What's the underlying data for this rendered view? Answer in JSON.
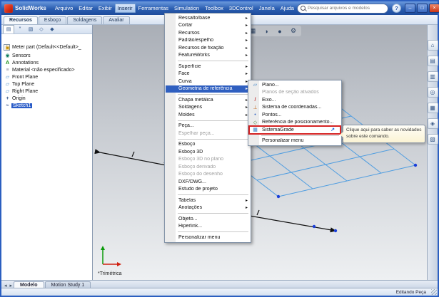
{
  "titlebar": {
    "app_name": "SolidWorks",
    "menus": [
      {
        "label": "Arquivo"
      },
      {
        "label": "Editar"
      },
      {
        "label": "Exibir"
      },
      {
        "label": "Inserir",
        "active": true
      },
      {
        "label": "Ferramentas"
      },
      {
        "label": "Simulation"
      },
      {
        "label": "Toolbox"
      },
      {
        "label": "3DControl"
      },
      {
        "label": "Janela"
      },
      {
        "label": "Ajuda"
      }
    ],
    "search_placeholder": "Pesquisar arquivos e modelos",
    "help_label": "?",
    "window_buttons": [
      {
        "name": "minimize-button",
        "glyph": "–"
      },
      {
        "name": "restore-button",
        "glyph": "□"
      },
      {
        "name": "close-button",
        "glyph": "×",
        "close": true
      }
    ]
  },
  "command_tabs": {
    "items": [
      {
        "label": "Recursos",
        "active": true
      },
      {
        "label": "Esboço"
      },
      {
        "label": "Soldagens"
      },
      {
        "label": "Avaliar"
      }
    ]
  },
  "feature_tree": {
    "root_label": "Meter part (Default<<Default>_",
    "items": [
      {
        "label": "Sensors",
        "icon": "sensors-icon"
      },
      {
        "label": "Annotations",
        "icon": "annotations-icon"
      },
      {
        "label": "Material <não especificado>",
        "icon": "material-icon"
      },
      {
        "label": "Front Plane",
        "icon": "plane-icon"
      },
      {
        "label": "Top Plane",
        "icon": "plane-icon"
      },
      {
        "label": "Right Plane",
        "icon": "plane-icon"
      },
      {
        "label": "Origin",
        "icon": "origin-icon"
      },
      {
        "label": "Sketch1",
        "icon": "sketch-icon",
        "selected": true
      }
    ]
  },
  "panel_tabs": {
    "items": [
      {
        "name": "featuremanager-tab-icon",
        "glyph": "▤",
        "active": true
      },
      {
        "name": "propertymanager-tab-icon",
        "glyph": "*"
      },
      {
        "name": "configurationmanager-tab-icon",
        "glyph": "▧"
      },
      {
        "name": "dimxpert-tab-icon",
        "glyph": "◇"
      },
      {
        "name": "displaymanager-tab-icon",
        "glyph": "◆"
      }
    ]
  },
  "insert_menu": {
    "items": [
      {
        "label": "Ressalto/base",
        "arrow": true
      },
      {
        "label": "Cortar",
        "arrow": true
      },
      {
        "label": "Recursos",
        "arrow": true
      },
      {
        "label": "Padrão/espelho",
        "arrow": true
      },
      {
        "label": "Recursos de fixação",
        "arrow": true
      },
      {
        "label": "FeatureWorks",
        "arrow": true
      },
      {
        "sep": true
      },
      {
        "label": "Superfície",
        "arrow": true
      },
      {
        "label": "Face",
        "arrow": true
      },
      {
        "label": "Curva",
        "arrow": true
      },
      {
        "label": "Geometria de referência",
        "arrow": true,
        "highlight": true
      },
      {
        "sep": true
      },
      {
        "label": "Chapa metálica",
        "arrow": true
      },
      {
        "label": "Soldagens",
        "arrow": true
      },
      {
        "label": "Moldes",
        "arrow": true
      },
      {
        "sep": true
      },
      {
        "label": "Peça..."
      },
      {
        "label": "Espelhar peça...",
        "disabled": true
      },
      {
        "sep": true
      },
      {
        "label": "Esboço"
      },
      {
        "label": "Esboço 3D"
      },
      {
        "label": "Esboço 3D no plano",
        "disabled": true
      },
      {
        "label": "Esboço derivado",
        "disabled": true
      },
      {
        "label": "Esboço do desenho",
        "disabled": true
      },
      {
        "label": "DXF/DWG..."
      },
      {
        "label": "Estudo de projeto"
      },
      {
        "sep": true
      },
      {
        "label": "Tabelas",
        "arrow": true
      },
      {
        "label": "Anotações",
        "arrow": true
      },
      {
        "sep": true
      },
      {
        "label": "Objeto..."
      },
      {
        "label": "Hiperlink..."
      },
      {
        "sep": true
      },
      {
        "label": "Personalizar menu"
      }
    ]
  },
  "ref_submenu": {
    "items": [
      {
        "label": "Plano...",
        "icon": "plane-icon"
      },
      {
        "label": "Planos de seção ativados",
        "disabled": true
      },
      {
        "label": "Eixo...",
        "icon": "axis-icon"
      },
      {
        "label": "Sistema de coordenadas...",
        "icon": "csys-icon"
      },
      {
        "label": "Pontos...",
        "icon": "point-icon"
      },
      {
        "label": "Referência de posicionamento...",
        "icon": "mate-icon"
      },
      {
        "label": "SistemaGrade",
        "icon": "grid-icon",
        "redbox": true
      },
      {
        "sep": true
      },
      {
        "label": "Personalizar menu"
      }
    ]
  },
  "tooltip": {
    "text": "Clique aqui para saber as novidades sobre este comando."
  },
  "view_toolbar": {
    "items": [
      {
        "name": "zoom-fit-icon",
        "glyph": "⊕"
      },
      {
        "name": "zoom-area-icon",
        "glyph": "⊡"
      },
      {
        "name": "previous-view-icon",
        "glyph": "↺"
      },
      {
        "name": "section-view-icon",
        "glyph": "◧"
      },
      {
        "name": "view-orientation-icon",
        "glyph": "▣"
      },
      {
        "name": "display-style-icon",
        "glyph": "▦"
      },
      {
        "name": "hide-show-items-icon",
        "glyph": "◑"
      },
      {
        "name": "edit-appearance-icon",
        "glyph": "●"
      },
      {
        "name": "apply-scene-icon",
        "glyph": "⚙"
      }
    ]
  },
  "task_pane": {
    "items": [
      {
        "name": "solidworks-resources-icon",
        "glyph": "⌂"
      },
      {
        "name": "design-library-icon",
        "glyph": "▤"
      },
      {
        "name": "file-explorer-icon",
        "glyph": "▥"
      },
      {
        "name": "search-icon",
        "glyph": "◎"
      },
      {
        "name": "view-palette-icon",
        "glyph": "▦"
      },
      {
        "name": "appearances-icon",
        "glyph": "◈"
      },
      {
        "name": "custom-properties-icon",
        "glyph": "▧"
      }
    ]
  },
  "bottom_tabs": {
    "items": [
      {
        "label": "Modelo",
        "active": true
      },
      {
        "label": "Motion Study 1"
      }
    ]
  },
  "viewport": {
    "view_label": "*Trimétrica"
  },
  "status": {
    "right": "Editando Peça"
  },
  "colors": {
    "titlebar_blue": "#2a5db0",
    "menu_highlight": "#2f5fc0",
    "selection_blue": "#2a5cc8",
    "annotation_red": "#d42222",
    "sketch_grid_blue": "#4f9de0",
    "sketch_point_blue": "#1a3ed8",
    "tooltip_yellow": "#fbf3d4"
  }
}
